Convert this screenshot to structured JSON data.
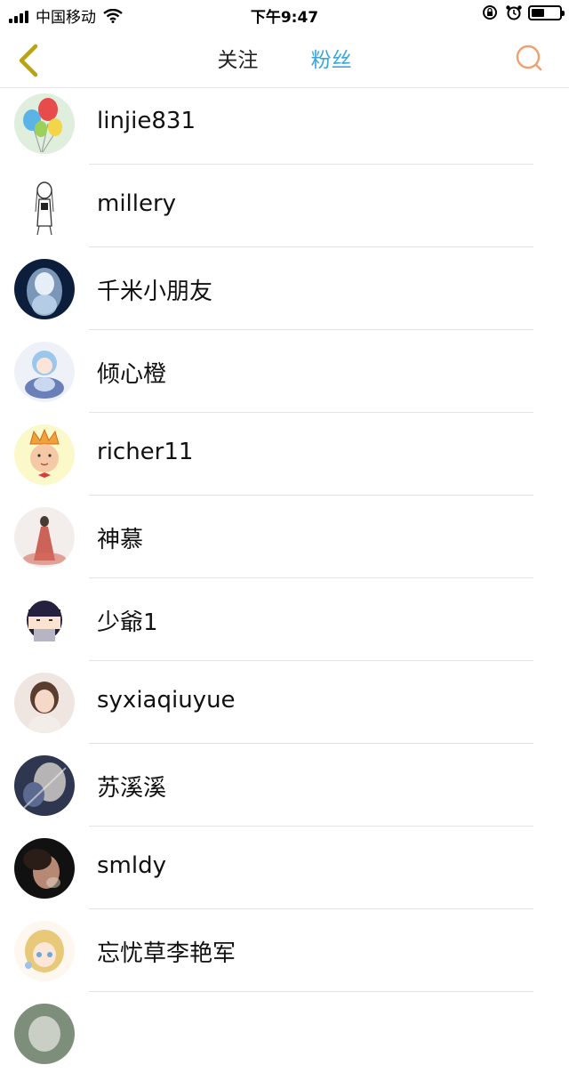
{
  "status_bar": {
    "carrier": "中国移动",
    "time": "下午9:47"
  },
  "nav": {
    "tabs": [
      {
        "label": "关注",
        "active": false
      },
      {
        "label": "粉丝",
        "active": true
      }
    ],
    "active_color": "#3aa6dd",
    "back_icon": "chevron-left-icon",
    "search_icon": "search-icon",
    "accent_back": "#b9a214",
    "accent_search": "#f0a070"
  },
  "fans": [
    {
      "name": "linjie831",
      "avatar": "balloons"
    },
    {
      "name": "millery",
      "avatar": "sketch-figure"
    },
    {
      "name": "千米小朋友",
      "avatar": "ghost-girl"
    },
    {
      "name": "倾心橙",
      "avatar": "anime-doll"
    },
    {
      "name": "richer11",
      "avatar": "king-cartoon"
    },
    {
      "name": "神慕",
      "avatar": "red-dress"
    },
    {
      "name": "少爺1",
      "avatar": "cartoon-boy"
    },
    {
      "name": "syxiaqiuyue",
      "avatar": "child-photo"
    },
    {
      "name": "苏溪溪",
      "avatar": "art-collage"
    },
    {
      "name": "smldy",
      "avatar": "dark-portrait"
    },
    {
      "name": "忘忧草李艳军",
      "avatar": "anime-blonde"
    },
    {
      "name": "",
      "avatar": "partial"
    }
  ]
}
